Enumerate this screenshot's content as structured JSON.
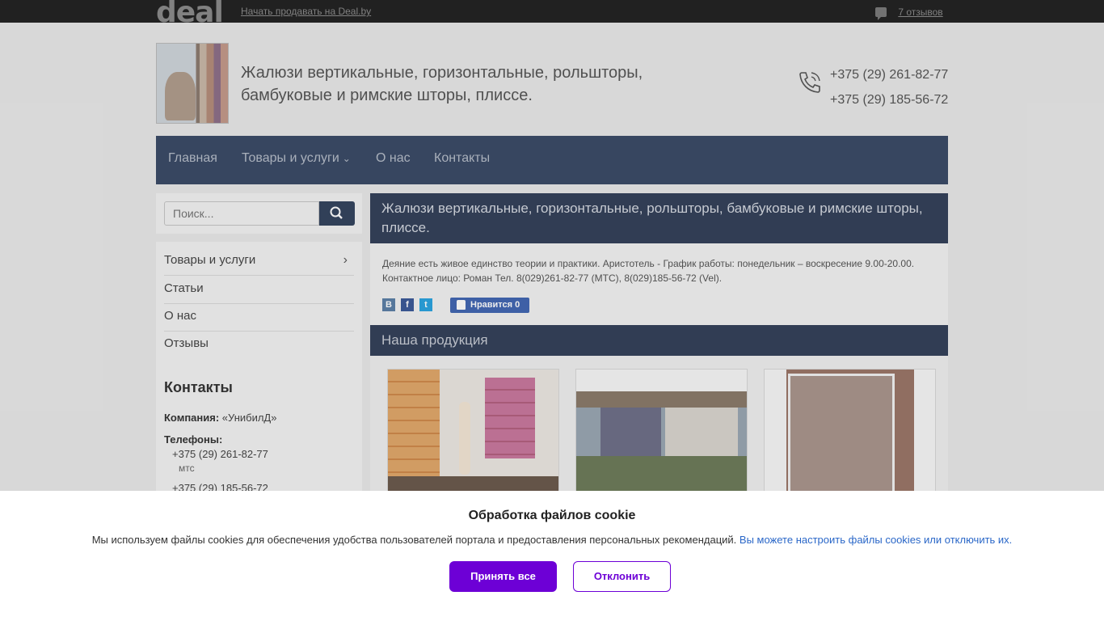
{
  "topbar": {
    "logo": "deal",
    "sell_link": "Начать продавать на Deal.by",
    "reviews_link": "7 отзывов"
  },
  "header": {
    "title": "Жалюзи вертикальные, горизонтальные, рольшторы, бамбуковые и римские шторы, плиссе.",
    "phone_1": "+375 (29) 261-82-77",
    "phone_2": "+375 (29) 185-56-72"
  },
  "nav": {
    "items": [
      {
        "label": "Главная"
      },
      {
        "label": "Товары и услуги"
      },
      {
        "label": "О нас"
      },
      {
        "label": "Контакты"
      }
    ]
  },
  "sidebar": {
    "search": {
      "placeholder": "Поиск..."
    },
    "menu": [
      {
        "label": "Товары и услуги"
      },
      {
        "label": "Статьи"
      },
      {
        "label": "О нас"
      },
      {
        "label": "Отзывы"
      }
    ],
    "contacts": {
      "title": "Контакты",
      "company_label": "Компания:",
      "company_value": "«УнибилД»",
      "phones_label": "Телефоны:",
      "phone_1": "+375 (29) 261-82-77",
      "phone_1_note": "мтс",
      "phone_2": "+375 (29) 185-56-72"
    }
  },
  "main": {
    "title": "Жалюзи вертикальные, горизонтальные, рольшторы, бамбуковые и римские шторы, плиссе.",
    "description": "Деяние есть живое единство теории и практики. Аристотель - График работы: понедельник – воскресение 9.00-20.00. Контактное лицо: Роман Тел. 8(029)261-82-77 (МТС), 8(029)185-56-72 (Vel).",
    "share": {
      "vk": "В",
      "fb": "f",
      "tw": "t"
    },
    "like_label": "Нравится",
    "like_count": "0",
    "products_title": "Наша продукция"
  },
  "cookie": {
    "title": "Обработка файлов cookie",
    "text": "Мы используем файлы cookies для обеспечения удобства пользователей портала и предоставления персональных рекомендаций.",
    "link": "Вы можете настроить файлы cookies или отключить их.",
    "accept": "Принять все",
    "decline": "Отклонить"
  },
  "colors": {
    "nav": "#3a4a66",
    "accent": "#6d00d6",
    "link": "#2a67c8"
  }
}
